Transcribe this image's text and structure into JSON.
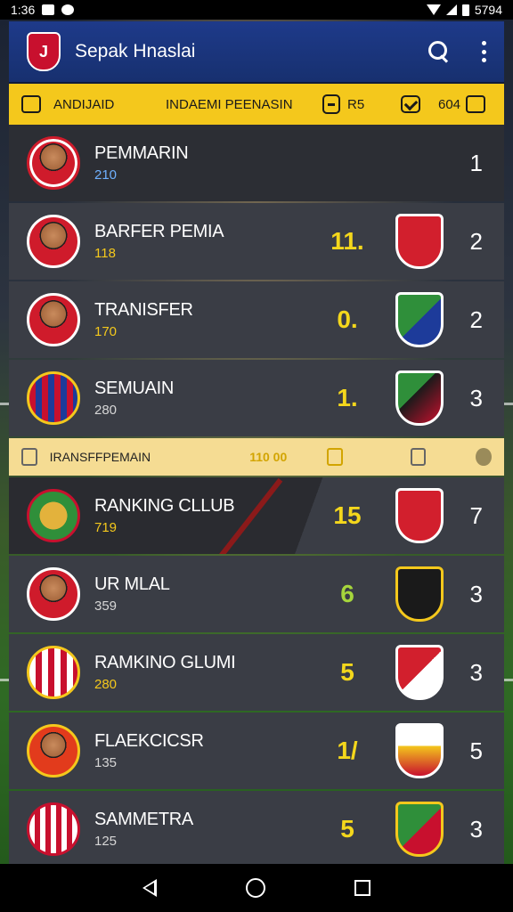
{
  "status_bar": {
    "time": "1:36",
    "battery_text": "5794"
  },
  "app_bar": {
    "title": "Sepak Hnaslai",
    "logo_text": "J"
  },
  "filter_bar": {
    "label_left": "ANDIJAID",
    "label_center": "INDAEMI PEENASIN",
    "value_1": "R5",
    "value_2": "604"
  },
  "rows": [
    {
      "name": "PEMMARIN",
      "sub": "210",
      "sub_color": "blue",
      "score": "",
      "rank": "1"
    },
    {
      "name": "BARFER PEMIA",
      "sub": "118",
      "sub_color": "yellow",
      "score": "11.",
      "rank": "2"
    },
    {
      "name": "TRANISFER",
      "sub": "170",
      "sub_color": "yellow",
      "score": "0.",
      "rank": "2"
    },
    {
      "name": "SEMUAIN",
      "sub": "280",
      "sub_color": "white",
      "score": "1.",
      "rank": "3"
    }
  ],
  "transfer_strip": {
    "label": "IRANSFFPEMAIN",
    "value": "110 00"
  },
  "rows_2": [
    {
      "name": "RANKING CLLUB",
      "sub": "719",
      "sub_color": "yellow",
      "score": "15",
      "rank": "7"
    },
    {
      "name": "UR MLAL",
      "sub": "359",
      "sub_color": "white",
      "score": "6",
      "rank": "3"
    },
    {
      "name": "RAMKINO GLUMI",
      "sub": "280",
      "sub_color": "yellow",
      "score": "5",
      "rank": "3"
    },
    {
      "name": "FLAEKCICSR",
      "sub": "135",
      "sub_color": "white",
      "score": "1/",
      "rank": "5"
    },
    {
      "name": "SAMMETRA",
      "sub": "125",
      "sub_color": "white",
      "score": "5",
      "rank": "3"
    }
  ]
}
